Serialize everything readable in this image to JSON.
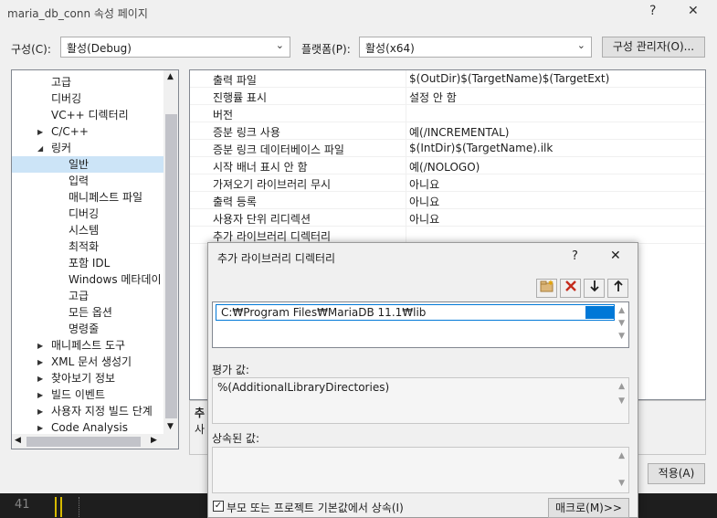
{
  "window": {
    "title": "maria_db_conn 속성 페이지",
    "help": "?",
    "close": "✕"
  },
  "config": {
    "label": "구성(C):",
    "value": "활성(Debug)"
  },
  "platform": {
    "label": "플랫폼(P):",
    "value": "활성(x64)"
  },
  "config_manager": {
    "label": "구성 관리자(O)..."
  },
  "tree": {
    "items": [
      {
        "label": "고급"
      },
      {
        "label": "디버깅"
      },
      {
        "label": "VC++ 디렉터리"
      },
      {
        "label": "C/C++",
        "arrow": "▶"
      },
      {
        "label": "링커",
        "arrow": "◢"
      },
      {
        "label": "일반"
      },
      {
        "label": "입력"
      },
      {
        "label": "매니페스트 파일"
      },
      {
        "label": "디버깅"
      },
      {
        "label": "시스템"
      },
      {
        "label": "최적화"
      },
      {
        "label": "포함 IDL"
      },
      {
        "label": "Windows 메타데이"
      },
      {
        "label": "고급"
      },
      {
        "label": "모든 옵션"
      },
      {
        "label": "명령줄"
      },
      {
        "label": "매니페스트 도구",
        "arrow": "▶"
      },
      {
        "label": "XML 문서 생성기",
        "arrow": "▶"
      },
      {
        "label": "찾아보기 정보",
        "arrow": "▶"
      },
      {
        "label": "빌드 이벤트",
        "arrow": "▶"
      },
      {
        "label": "사용자 지정 빌드 단계",
        "arrow": "▶"
      },
      {
        "label": "Code Analysis",
        "arrow": "▶"
      }
    ]
  },
  "grid": {
    "rows": [
      {
        "name": "출력 파일",
        "value": "$(OutDir)$(TargetName)$(TargetExt)"
      },
      {
        "name": "진행률 표시",
        "value": "설정 안 함"
      },
      {
        "name": "버전",
        "value": ""
      },
      {
        "name": "증분 링크 사용",
        "value": "예(/INCREMENTAL)"
      },
      {
        "name": "증분 링크 데이터베이스 파일",
        "value": "$(IntDir)$(TargetName).ilk"
      },
      {
        "name": "시작 배너 표시 안 함",
        "value": "예(/NOLOGO)"
      },
      {
        "name": "가져오기 라이브러리 무시",
        "value": "아니요"
      },
      {
        "name": "출력 등록",
        "value": "아니요"
      },
      {
        "name": "사용자 단위 리디렉션",
        "value": "아니요"
      },
      {
        "name": "추가 라이브러리 디렉터리",
        "value": ""
      }
    ]
  },
  "description": {
    "line1": "추",
    "line2": "사"
  },
  "apply": {
    "label": "적용(A)"
  },
  "editor": {
    "line_number": "41"
  },
  "dialog": {
    "title": "추가 라이브러리 디렉터리",
    "help": "?",
    "close": "✕",
    "path": "C:₩Program Files₩MariaDB 11.1₩lib",
    "evaluated_label": "평가 값:",
    "evaluated_value": "%(AdditionalLibraryDirectories)",
    "inherited_label": "상속된 값:",
    "inherit_checkbox": "부모 또는 프로젝트 기본값에서 상속(I)",
    "macro_button": "매크로(M)>>"
  }
}
